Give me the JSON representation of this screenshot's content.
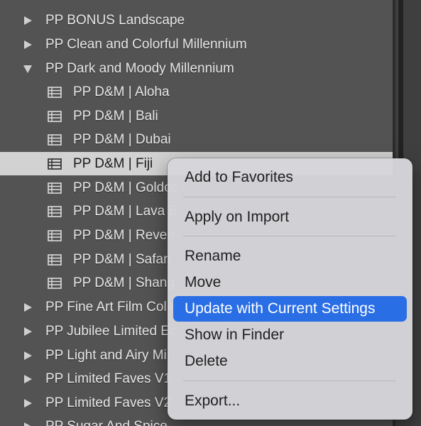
{
  "tree": {
    "folders_top": [
      {
        "label": "PP BONUS Landscape",
        "expanded": false
      },
      {
        "label": "PP Clean and Colorful Millennium",
        "expanded": false
      },
      {
        "label": "PP Dark and Moody Millennium",
        "expanded": true
      }
    ],
    "presets": [
      {
        "label": "PP D&M | Aloha"
      },
      {
        "label": "PP D&M | Bali"
      },
      {
        "label": "PP D&M | Dubai"
      },
      {
        "label": "PP D&M | Fiji",
        "selected": true
      },
      {
        "label": "PP D&M | Goldcc"
      },
      {
        "label": "PP D&M | Lava E"
      },
      {
        "label": "PP D&M | Reveri"
      },
      {
        "label": "PP D&M | Safari"
      },
      {
        "label": "PP D&M | Shang"
      }
    ],
    "folders_bottom": [
      {
        "label": "PP Fine Art Film Colle",
        "expanded": false
      },
      {
        "label": "PP Jubilee Limited Ec",
        "expanded": false
      },
      {
        "label": "PP Light and Airy Mil",
        "expanded": false
      },
      {
        "label": "PP Limited Faves V1",
        "expanded": false
      },
      {
        "label": "PP Limited Faves V2",
        "expanded": false
      },
      {
        "label": "PP Sugar And Spice",
        "expanded": false
      }
    ]
  },
  "context_menu": {
    "items": [
      {
        "label": "Add to Favorites"
      },
      {
        "label": "Apply on Import"
      },
      {
        "label": "Rename"
      },
      {
        "label": "Move"
      },
      {
        "label": "Update with Current Settings",
        "highlighted": true
      },
      {
        "label": "Show in Finder"
      },
      {
        "label": "Delete"
      },
      {
        "label": "Export..."
      }
    ]
  },
  "colors": {
    "panel_bg": "#535353",
    "selected_row_bg": "#d2d2d2",
    "menu_bg": "#d6d6da",
    "menu_highlight": "#2a6ee5",
    "text_light": "#e6e6e6",
    "text_dark": "#202020"
  },
  "icons": {
    "collapsed": "disclosure-triangle-right-icon",
    "expanded": "disclosure-triangle-down-icon",
    "preset": "preset-list-icon"
  }
}
